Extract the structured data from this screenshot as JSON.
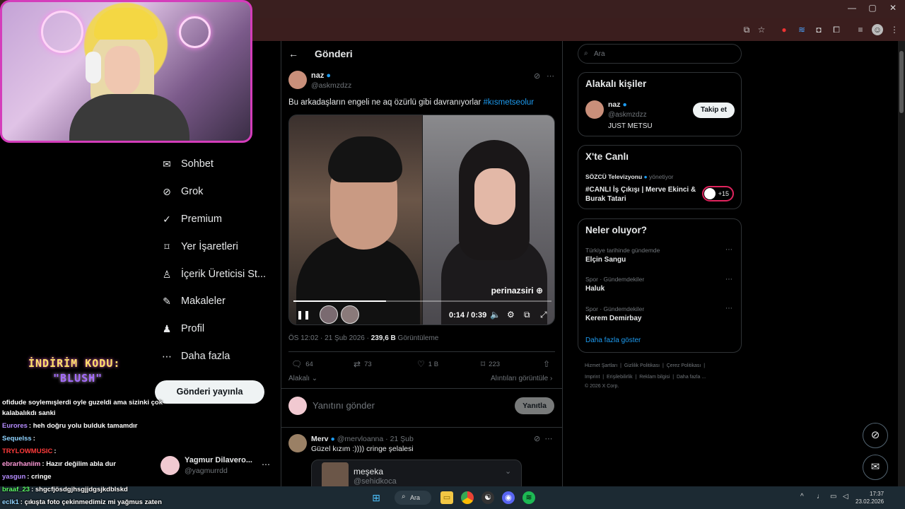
{
  "browser": {
    "window_controls": [
      "—",
      "▢",
      "✕"
    ]
  },
  "stream": {
    "promo_line1": "İNDİRİM KODU:",
    "promo_line2": "\"BLUSH\""
  },
  "chat": [
    {
      "user": "",
      "text": "ofidude soylemışlerdi oyle guzeldi ama sizinki çok",
      "color": "#ffffff"
    },
    {
      "user": "",
      "text": "kalabalıkdı sanki",
      "color": "#ffffff"
    },
    {
      "user": "Eurores",
      "text": ": heh doğru yolu bulduk tamamdır",
      "color": "#b58cff"
    },
    {
      "user": "Sequelss",
      "text": ":",
      "color": "#8fd3ff"
    },
    {
      "user": "TRYLOWMUSIC",
      "text": ":",
      "color": "#ff3b3b"
    },
    {
      "user": "ebrarhaniim",
      "text": ": Hazır değilim abla dur",
      "color": "#ff9ad8"
    },
    {
      "user": "yasgun",
      "text": ": cringe",
      "color": "#b58cff"
    },
    {
      "user": "braaf_23",
      "text": ": shgcfjösdgjhsgjjdgsjkdblskd",
      "color": "#5fff6a"
    },
    {
      "user": "eclk1",
      "text": ": çıkışta foto çekinmedimiz mi yağmus zaten",
      "color": "#8fd3ff"
    }
  ],
  "nav": {
    "items": [
      {
        "label": "Sohbet",
        "icon": "envelope-icon"
      },
      {
        "label": "Grok",
        "icon": "grok-icon"
      },
      {
        "label": "Premium",
        "icon": "verified-icon"
      },
      {
        "label": "Yer İşaretleri",
        "icon": "bookmark-icon"
      },
      {
        "label": "İçerik Üreticisi St...",
        "icon": "creator-icon"
      },
      {
        "label": "Makaleler",
        "icon": "article-icon"
      },
      {
        "label": "Profil",
        "icon": "person-icon"
      },
      {
        "label": "Daha fazla",
        "icon": "more-icon"
      }
    ],
    "post_button": "Gönderi yayınla",
    "account": {
      "name": "Yagmur Dilavero...",
      "handle": "@yagmurrdd"
    }
  },
  "post": {
    "page_title": "Gönderi",
    "author_name": "naz",
    "author_handle": "@askmzdzz",
    "text": "Bu arkadaşların engeli ne aq özürlü gibi davranıyorlar ",
    "hashtag": "#kısmetseolur",
    "video": {
      "time": "0:14 / 0:39",
      "watermark": "perinazsiri",
      "progress": 0.36
    },
    "time": "ÖS 12:02 · 21 Şub 2026 · ",
    "views": "239,6 B",
    "views_label": " Görüntüleme",
    "stats": {
      "replies": "64",
      "reposts": "73",
      "likes": "1 B",
      "bookmarks": "223"
    },
    "related_label": "Alakalı",
    "quotes_label": "Alıntıları görüntüle",
    "reply_placeholder": "Yanıtını gönder",
    "reply_button": "Yanıtla"
  },
  "comment": {
    "name": "Merv",
    "handle": "@mervloanna",
    "date": "· 21 Şub",
    "text": "Güzel kızım :))))  cringe şelalesi",
    "embed_name": "meşeka",
    "embed_handle": "@sehidkoca"
  },
  "sidebar": {
    "search_placeholder": "Ara",
    "people_title": "Alakalı kişiler",
    "person": {
      "name": "naz",
      "handle": "@askmzdzz",
      "bio": "JUST METSU",
      "follow": "Takip et"
    },
    "live_title": "X'te Canlı",
    "live": {
      "host": "SÖZCÜ Televizyonu",
      "role": " yönetiyor",
      "title": "#CANLI İş Çıkışı | Merve Ekinci & Burak Tatari",
      "count": "+15"
    },
    "trends_title": "Neler oluyor?",
    "trends": [
      {
        "category": "Türkiye tarihinde gündemde",
        "name": "Elçin Sangu"
      },
      {
        "category": "Spor · Gündemdekiler",
        "name": "Haluk"
      },
      {
        "category": "Spor · Gündemdekiler",
        "name": "Kerem Demirbay"
      }
    ],
    "show_more": "Daha fazla göster",
    "footer_line1": [
      "Hizmet Şartları",
      "Gizlilik Politikası",
      "Çerez Politikası"
    ],
    "footer_line2": [
      "Imprint",
      "Erişilebilirlik",
      "Reklam bilgisi",
      "Daha fazla ..."
    ],
    "copyright": "© 2026 X Corp."
  },
  "taskbar": {
    "search": "Ara",
    "time": "17:37",
    "date": "23.02.2026"
  },
  "colors": {
    "accent": "#1d9bf0",
    "webcam_border": "#d43dbb",
    "background": "#000000"
  }
}
